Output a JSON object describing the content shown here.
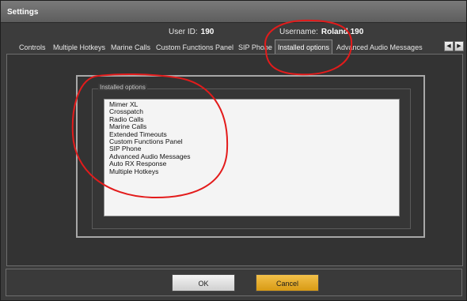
{
  "window": {
    "title": "Settings"
  },
  "user": {
    "id_label": "User ID:",
    "id_value": "190",
    "name_label": "Username:",
    "name_value": "Roland 190"
  },
  "tabs": [
    {
      "label": "Controls"
    },
    {
      "label": "Multiple Hotkeys"
    },
    {
      "label": "Marine Calls"
    },
    {
      "label": "Custom Functions Panel"
    },
    {
      "label": "SIP Phone"
    },
    {
      "label": "Installed options"
    },
    {
      "label": "Advanced Audio Messages"
    }
  ],
  "installed_options": {
    "group_title": "Installed options",
    "items": [
      "Mimer XL",
      "Crosspatch",
      "Radio Calls",
      "Marine Calls",
      "Extended Timeouts",
      "Custom Functions Panel",
      "SIP Phone",
      "Advanced Audio Messages",
      "Auto RX Response",
      "Multiple Hotkeys"
    ]
  },
  "buttons": {
    "ok": "OK",
    "cancel": "Cancel"
  },
  "colors": {
    "accent": "#d89a14",
    "annotation": "#e31b1b"
  },
  "icons": {
    "tab_left": "arrow-left-icon",
    "tab_right": "arrow-right-icon"
  }
}
